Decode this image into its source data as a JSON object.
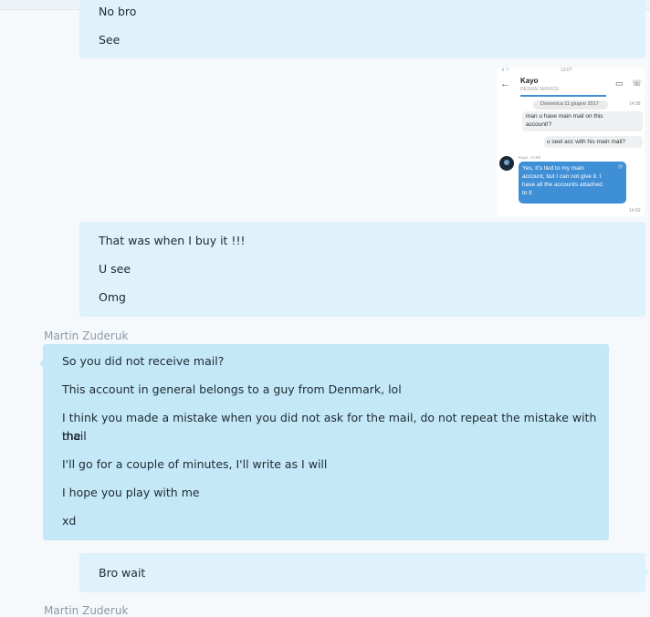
{
  "messages": [
    {
      "lines": [
        "No bro",
        "See"
      ]
    },
    {
      "lines": [
        "That was when I buy it !!!",
        "U see",
        "Omg"
      ]
    },
    {
      "sender": "Martin Zuderuk",
      "lines": [
        "So you did not receive mail?",
        "This account in general belongs to a guy from Denmark, lol",
        "I think you made a mistake when you did not ask for the mail, do not repeat the mistake with the",
        "mail",
        "I'll go for a couple of minutes, I'll write as I will",
        "I hope you play with me",
        "xd"
      ]
    },
    {
      "lines": [
        "Bro wait"
      ]
    },
    {
      "sender": "Martin Zuderuk"
    }
  ],
  "screenshot": {
    "contact_name": "Kayo",
    "contact_sub": "DESIGN SERVICE",
    "date_chip": "Domenica 11 giugno 2017",
    "time1": "14:58",
    "bubble1": [
      "man u have main mail on this",
      "account!?"
    ],
    "bubble2": "u seel acc with his main mail?",
    "reply_meta": "Kayo, 14:59",
    "reply_lines": [
      "Yes, it's tied to my main",
      "account, but I can not give it. I",
      "have all the accounts attached",
      "to it"
    ],
    "time2": "14:59",
    "status_time": "13:07"
  },
  "colors": {
    "mine_bubble": "#dff1fa",
    "their_bubble": "#c4e8f7",
    "reply_bubble": "#3f8fd6"
  }
}
